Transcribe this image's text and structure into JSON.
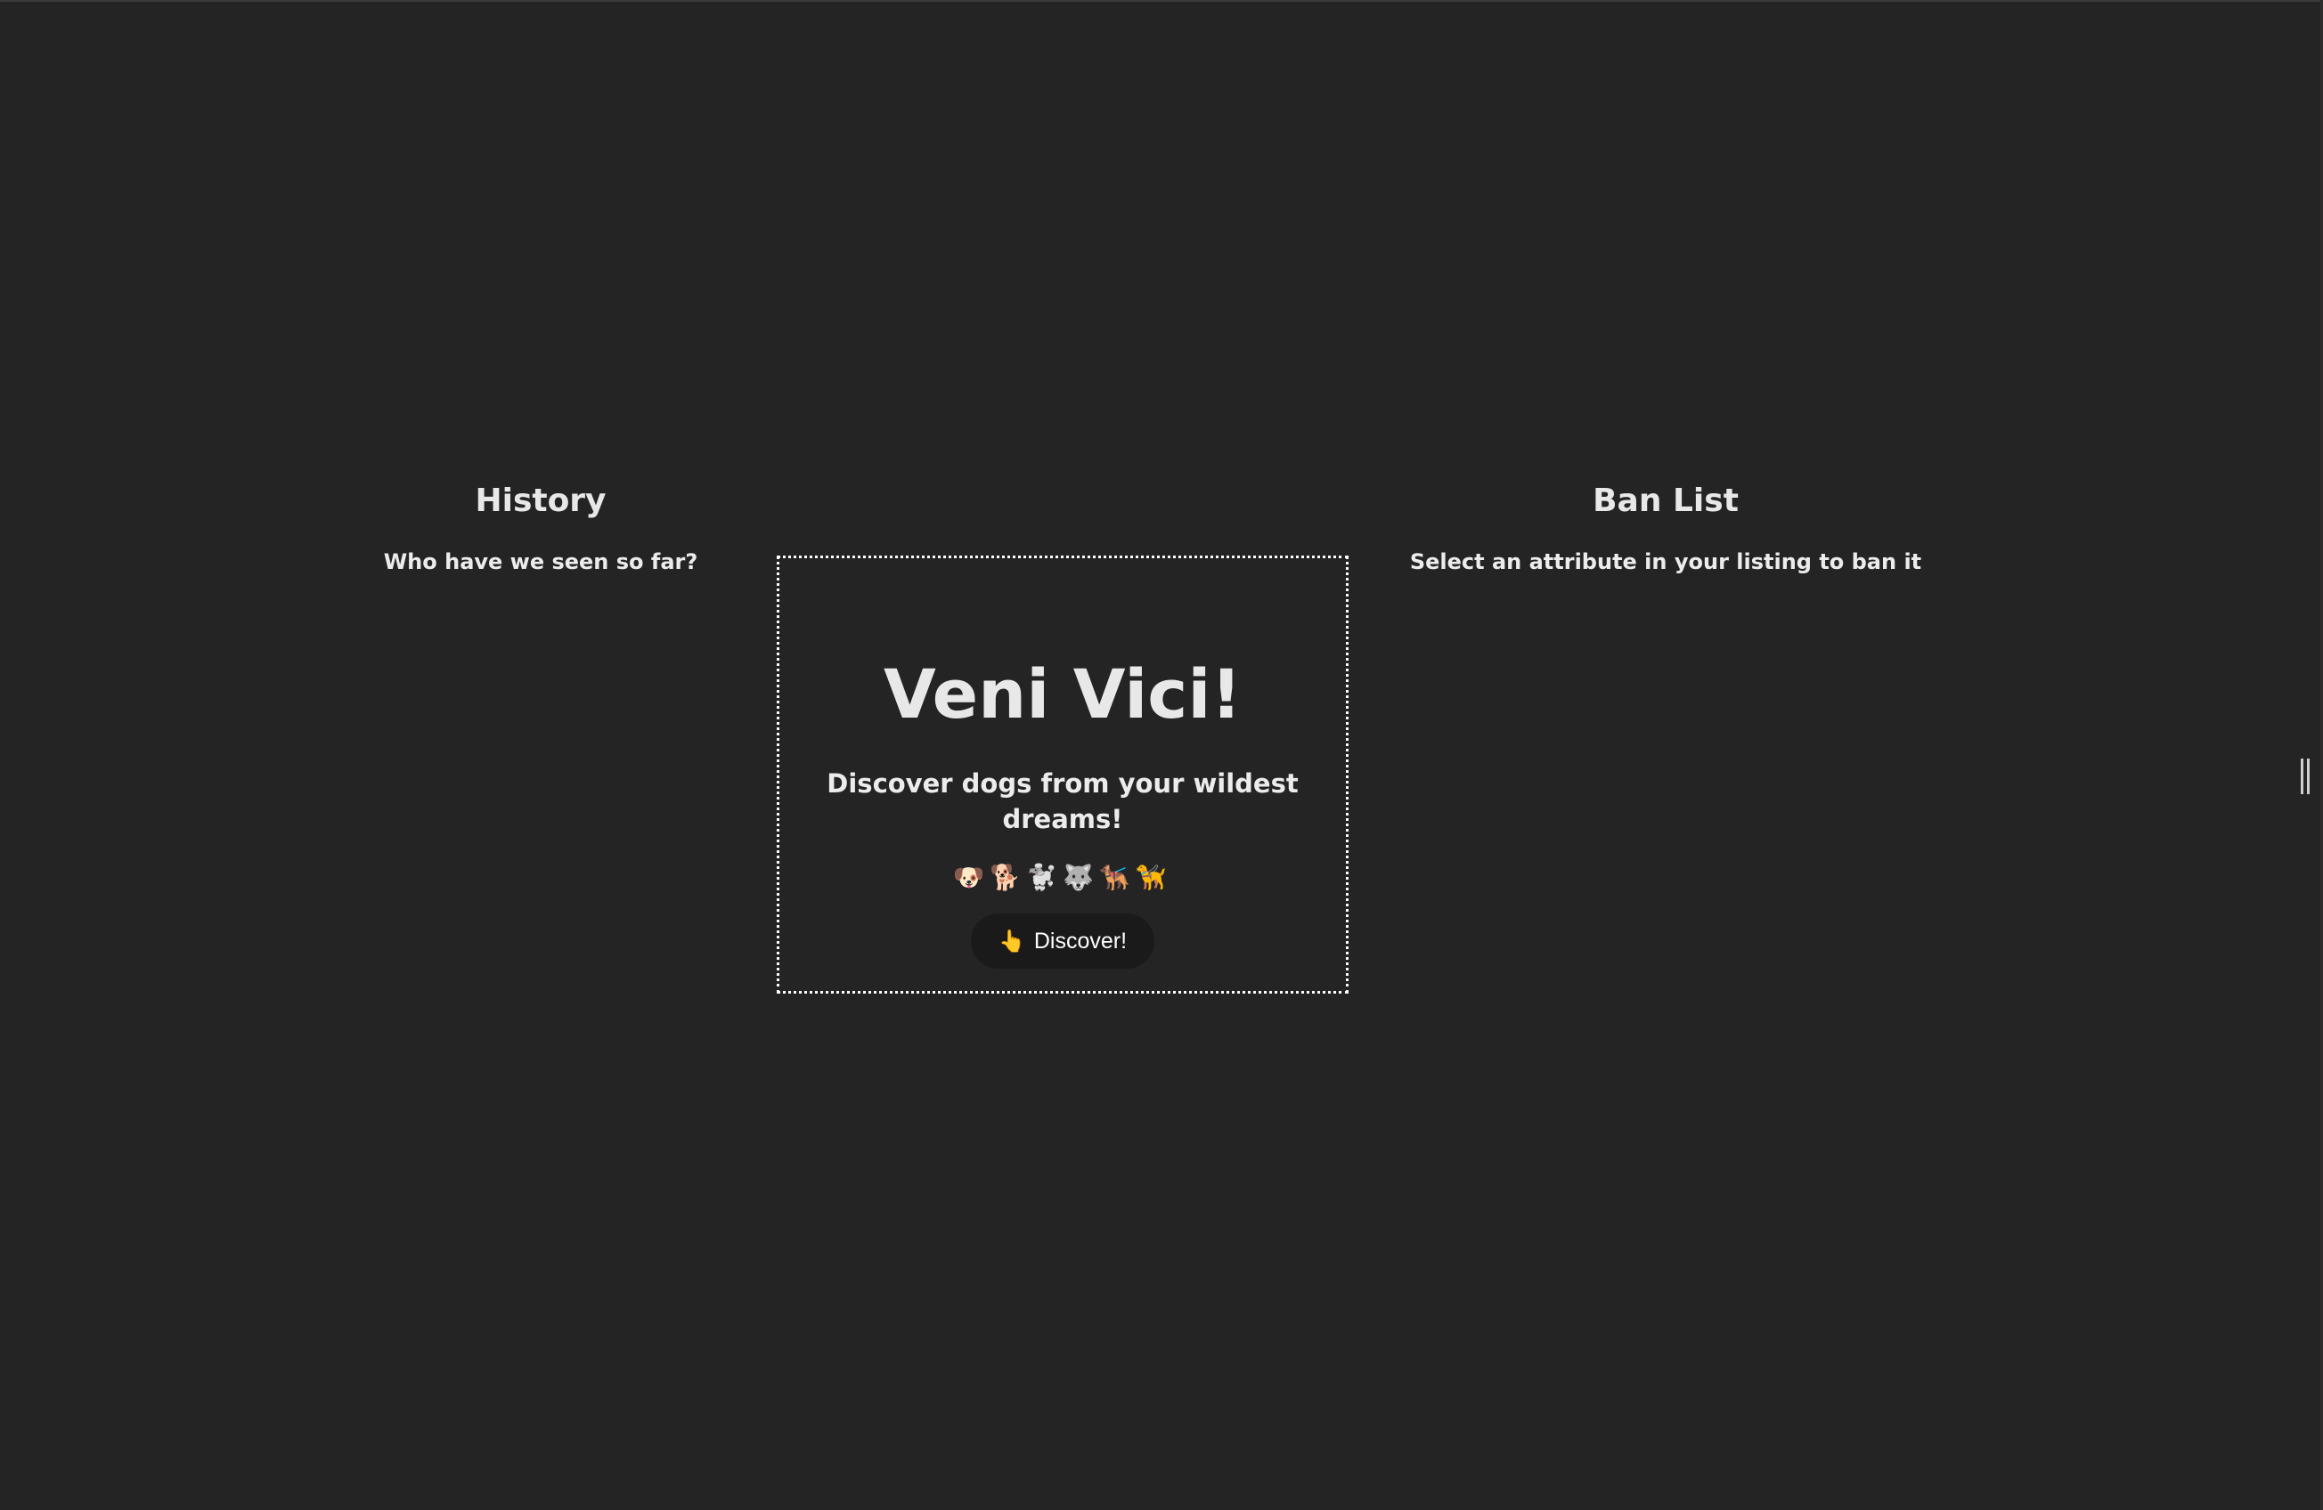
{
  "history": {
    "title": "History",
    "subtitle": "Who have we seen so far?"
  },
  "main": {
    "title": "Veni Vici!",
    "subtitle": "Discover dogs from your wildest dreams!",
    "emojis": "🐶🐕🐩🐺🐕‍🦺🦮",
    "button_icon": "pointing-hand-icon",
    "button_glyph": "👆",
    "button_label": "Discover!"
  },
  "banlist": {
    "title": "Ban List",
    "subtitle": "Select an attribute in your listing to ban it"
  },
  "colors": {
    "background": "#242424",
    "text": "#e8e8e8",
    "button_bg": "#1a1a1a",
    "card_border": "#ffffff"
  }
}
